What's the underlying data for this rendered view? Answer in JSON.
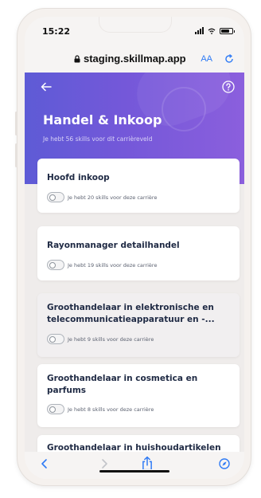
{
  "status_bar": {
    "time": "15:22"
  },
  "browser": {
    "url": "staging.skillmap.app",
    "text_size_label": "AA"
  },
  "header": {
    "title": "Handel & Inkoop",
    "subtitle": "Je hebt 56 skills voor dit carrièreveld"
  },
  "careers": [
    {
      "title": "Hoofd inkoop",
      "meta": "Je hebt 20 skills voor deze carrière"
    },
    {
      "title": "Rayonmanager detailhandel",
      "meta": "Je hebt 19 skills voor deze carrière"
    },
    {
      "title": "Groothandelaar in elektronische en telecommunicatieapparatuur en -...",
      "meta": "Je hebt 9 skills voor deze carrière"
    },
    {
      "title": "Groothandelaar in cosmetica en parfums",
      "meta": "Je hebt 8 skills voor deze carrière"
    },
    {
      "title": "Groothandelaar in huishoudartikelen"
    }
  ],
  "icons": {
    "back": "arrow-left-icon",
    "help": "question-circle-icon",
    "lock": "lock-icon",
    "reload": "reload-icon",
    "share": "share-icon",
    "compass": "compass-icon"
  },
  "colors": {
    "header_start": "#5e5bd6",
    "header_end": "#8b5fdd",
    "accent_blue": "#2f7bf5",
    "card_title": "#1f2a44"
  }
}
